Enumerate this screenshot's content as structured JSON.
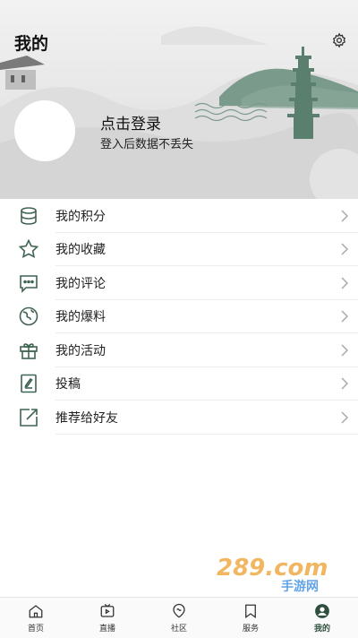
{
  "header": {
    "title": "我的",
    "settings_icon": "gear-icon"
  },
  "profile": {
    "login_title": "点击登录",
    "login_subtitle": "登入后数据不丢失"
  },
  "menu": {
    "items": [
      {
        "label": "我的积分",
        "icon": "coins-icon"
      },
      {
        "label": "我的收藏",
        "icon": "star-icon"
      },
      {
        "label": "我的评论",
        "icon": "comment-icon"
      },
      {
        "label": "我的爆料",
        "icon": "globe-icon"
      },
      {
        "label": "我的活动",
        "icon": "gift-icon"
      },
      {
        "label": "投稿",
        "icon": "document-edit-icon"
      },
      {
        "label": "推荐给好友",
        "icon": "share-icon"
      }
    ]
  },
  "tabbar": {
    "tabs": [
      {
        "label": "首页",
        "icon": "home-icon",
        "active": false
      },
      {
        "label": "直播",
        "icon": "tv-icon",
        "active": false
      },
      {
        "label": "社区",
        "icon": "community-icon",
        "active": false
      },
      {
        "label": "服务",
        "icon": "bookmark-icon",
        "active": false
      },
      {
        "label": "我的",
        "icon": "user-icon",
        "active": true
      }
    ]
  },
  "watermark": {
    "text": "289.com",
    "subtext": "手游网"
  },
  "colors": {
    "accent": "#2e4f3e",
    "icon_stroke": "#3f6452",
    "text": "#222222"
  }
}
